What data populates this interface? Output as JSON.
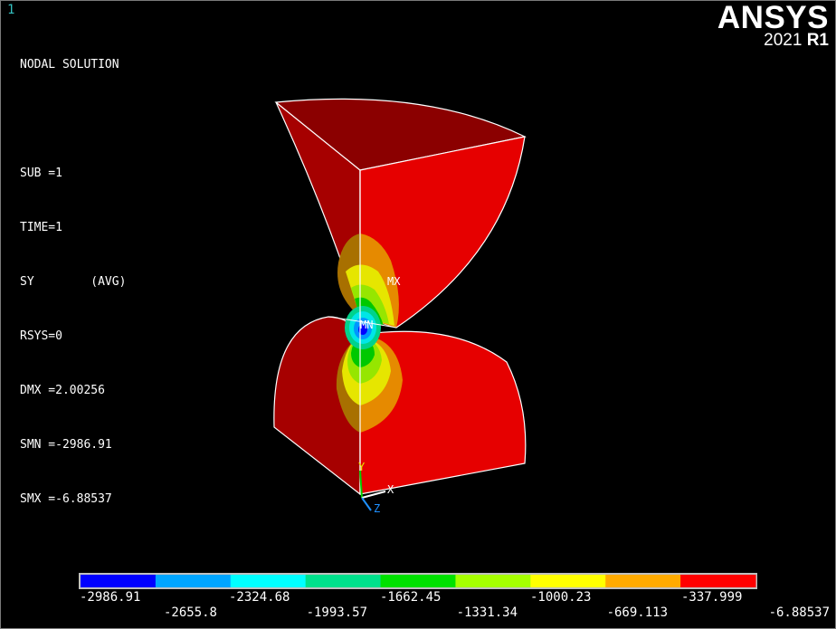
{
  "window_number": "1",
  "header": {
    "title": "NODAL SOLUTION",
    "sub": "SUB =1",
    "time": "TIME=1",
    "component": "SY        (AVG)",
    "rsys": "RSYS=0",
    "dmx": "DMX =2.00256",
    "smn": "SMN =-2986.91",
    "smx": "SMX =-6.88537"
  },
  "logo": {
    "brand": "ANSYS",
    "year": "2021",
    "release": "R1"
  },
  "markers": {
    "max": "MX",
    "min": "MN"
  },
  "triad": {
    "x": "X",
    "y": "Y",
    "z": "Z"
  },
  "legend": {
    "colors": [
      "#0000ff",
      "#00a5ff",
      "#00ffff",
      "#00e18c",
      "#00e100",
      "#a5ff00",
      "#ffff00",
      "#ffaa00",
      "#ff0000"
    ],
    "top_labels": [
      "-2986.91",
      "-2324.68",
      "-1662.45",
      "-1000.23",
      "-337.999"
    ],
    "bottom_labels": [
      "-2655.8",
      "-1993.57",
      "-1331.34",
      "-669.113",
      "-6.88537"
    ]
  }
}
